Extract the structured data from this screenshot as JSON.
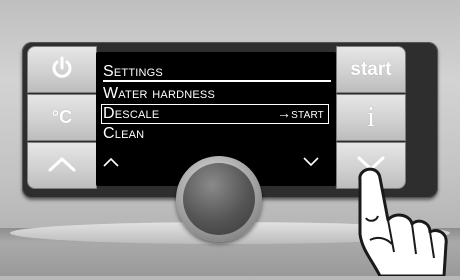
{
  "display": {
    "title": "Settings",
    "items": [
      {
        "label": "Water hardness"
      },
      {
        "label": "Descale",
        "action": "→start",
        "selected": true
      },
      {
        "label": "Clean"
      }
    ]
  },
  "left_buttons": [
    {
      "icon": "power-icon"
    },
    {
      "label": "°C"
    },
    {
      "icon": "chevron-up-icon"
    }
  ],
  "right_buttons": [
    {
      "label": "start"
    },
    {
      "label": "i"
    },
    {
      "icon": "chevron-down-icon"
    }
  ],
  "colors": {
    "screen_bg": "#000000",
    "screen_text": "#ffffff",
    "button_face": "#d4d4d4",
    "bezel": "#2e2e2e"
  }
}
